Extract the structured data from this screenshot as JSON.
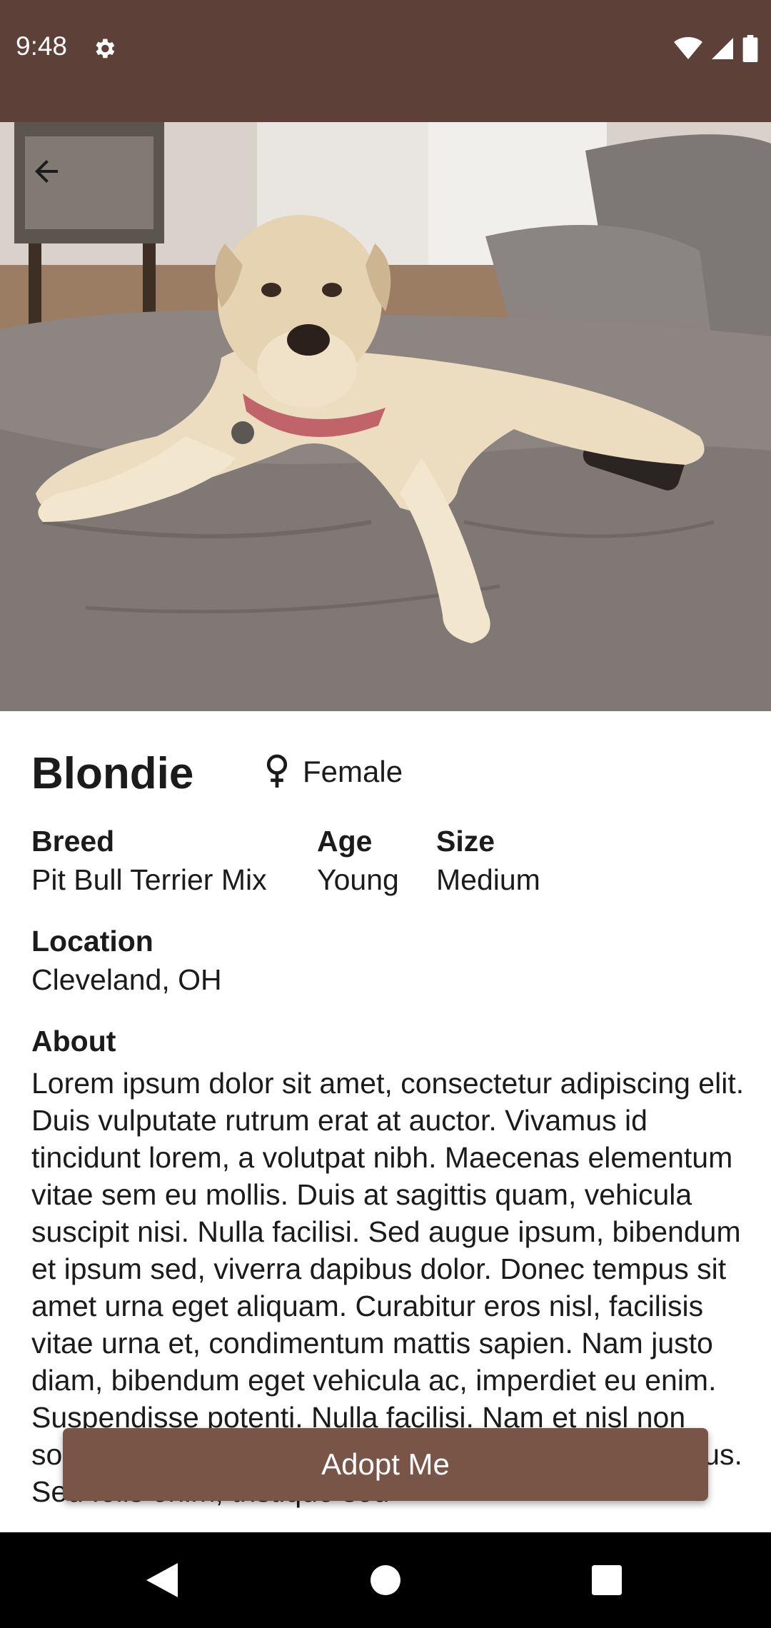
{
  "status_bar": {
    "time": "9:48",
    "background": "#5d4037",
    "icons": [
      "gear-icon",
      "wifi-icon",
      "signal-icon",
      "battery-icon"
    ]
  },
  "hero": {
    "image": "dog-photo",
    "back_icon": "arrow-back-icon"
  },
  "pet": {
    "name": "Blondie",
    "gender_icon": "female-icon",
    "gender": "Female",
    "breed_label": "Breed",
    "breed": "Pit Bull Terrier Mix",
    "age_label": "Age",
    "age": "Young",
    "size_label": "Size",
    "size": "Medium",
    "location_label": "Location",
    "location": "Cleveland, OH",
    "about_label": "About",
    "about": "Lorem ipsum dolor sit amet, consectetur adipiscing elit. Duis vulputate rutrum erat at auctor. Vivamus id tincidunt lorem, a volutpat nibh. Maecenas elementum vitae sem eu mollis. Duis at sagittis quam, vehicula suscipit nisi. Nulla facilisi. Sed augue ipsum, bibendum et ipsum sed, viverra dapibus dolor. Donec tempus sit amet urna eget aliquam. Curabitur eros nisl, facilisis vitae urna et, condimentum mattis sapien. Nam justo diam, bibendum eget vehicula ac, imperdiet eu enim. Suspendisse potenti. Nulla facilisi. Nam et nisl non sollicitudin lorem. Nunc pellentesque malesuada lacus. Sed felis enim, tristique sed"
  },
  "actions": {
    "adopt_label": "Adopt Me",
    "accent": "#795548"
  },
  "nav_bar": {
    "icons": [
      "back-triangle-icon",
      "home-circle-icon",
      "recents-square-icon"
    ]
  }
}
